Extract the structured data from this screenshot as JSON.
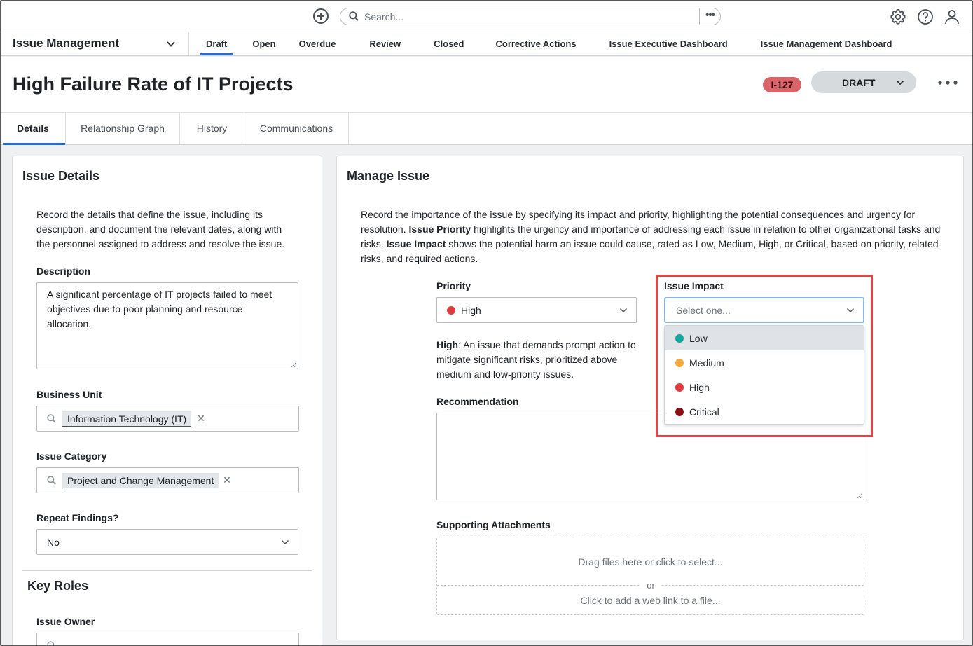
{
  "topbar": {
    "search_placeholder": "Search...",
    "more_label": "•••"
  },
  "nav": {
    "app_name": "Issue Management",
    "tabs": [
      "Draft",
      "Open",
      "Overdue",
      "Review",
      "Closed",
      "Corrective Actions",
      "Issue Executive Dashboard",
      "Issue Management Dashboard"
    ],
    "active_tab": "Draft"
  },
  "record": {
    "title": "High Failure Rate of IT Projects",
    "id": "I-127",
    "state": "DRAFT"
  },
  "tabs": [
    "Details",
    "Relationship Graph",
    "History",
    "Communications"
  ],
  "issue_details": {
    "title": "Issue Details",
    "intro": "Record the details that define the issue, including its description, and document the relevant dates, along with the personnel assigned to address and resolve the issue.",
    "description_label": "Description",
    "description_value": "A significant percentage of IT projects failed to meet objectives due to poor planning and resource allocation.",
    "business_unit_label": "Business Unit",
    "business_unit_value": "Information Technology (IT)",
    "issue_category_label": "Issue Category",
    "issue_category_value": "Project and Change Management",
    "repeat_findings_label": "Repeat Findings?",
    "repeat_findings_value": "No"
  },
  "key_roles": {
    "title": "Key Roles",
    "issue_owner_label": "Issue Owner"
  },
  "manage_issue": {
    "title": "Manage Issue",
    "intro_part1": "Record the importance of the issue by specifying its impact and priority, highlighting the potential consequences and urgency for resolution. ",
    "intro_bold1": "Issue Priority",
    "intro_part2": " highlights the urgency and importance of addressing each issue in relation to other organizational tasks and risks. ",
    "intro_bold2": "Issue Impact",
    "intro_part3": " shows the potential harm an issue could cause, rated as Low, Medium, High, or Critical, based on priority, related risks, and required actions.",
    "priority_label": "Priority",
    "priority_value": "High",
    "priority_color": "#e0393e",
    "priority_desc_bold": "High",
    "priority_desc": ": An issue that demands prompt action to mitigate significant risks, prioritized above medium and low-priority issues.",
    "impact_label": "Issue Impact",
    "impact_placeholder": "Select one...",
    "impact_options": [
      {
        "label": "Low",
        "color": "#13a89e"
      },
      {
        "label": "Medium",
        "color": "#f5a93a"
      },
      {
        "label": "High",
        "color": "#e0393e"
      },
      {
        "label": "Critical",
        "color": "#8b1014"
      }
    ],
    "recommendation_label": "Recommendation",
    "attachments_label": "Supporting Attachments",
    "attach_drag": "Drag files here or click to select...",
    "attach_or": "or",
    "attach_weblink": "Click to add a web link to a file..."
  },
  "colors": {
    "accent": "#1f6fcf",
    "highlight": "#e1454a",
    "id_badge": "#d9656b"
  }
}
